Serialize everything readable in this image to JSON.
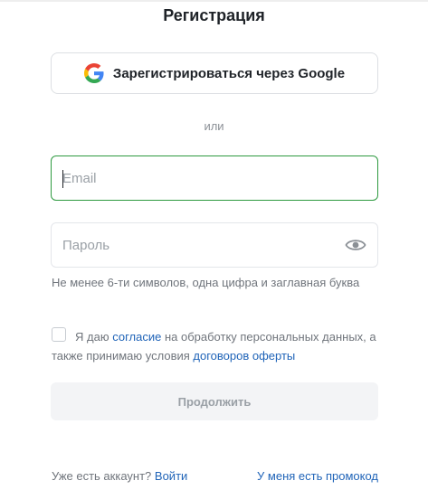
{
  "page": {
    "title": "Регистрация"
  },
  "google_button": {
    "label": "Зарегистрироваться через Google",
    "icon": "google-logo-icon"
  },
  "divider": {
    "text": "или"
  },
  "email_field": {
    "placeholder": "Email",
    "value": ""
  },
  "password_field": {
    "placeholder": "Пароль",
    "value": "",
    "toggle_icon": "eye-icon"
  },
  "password_hint": "Не менее 6-ти символов, одна цифра и заглавная буква",
  "consent": {
    "checked": false,
    "text_before": "Я даю ",
    "consent_link": "согласие",
    "text_middle": " на обработку персональных данных, а также принимаю условия ",
    "offer_link": "договоров оферты"
  },
  "continue_button": {
    "label": "Продолжить",
    "disabled": true
  },
  "footer": {
    "have_account_text": "Уже есть аккаунт?",
    "login_link": "Войти",
    "promo_link": "У меня есть промокод"
  },
  "colors": {
    "link": "#2064b8",
    "focus_border": "#2e9a40",
    "disabled_button_bg": "#f3f4f6"
  }
}
